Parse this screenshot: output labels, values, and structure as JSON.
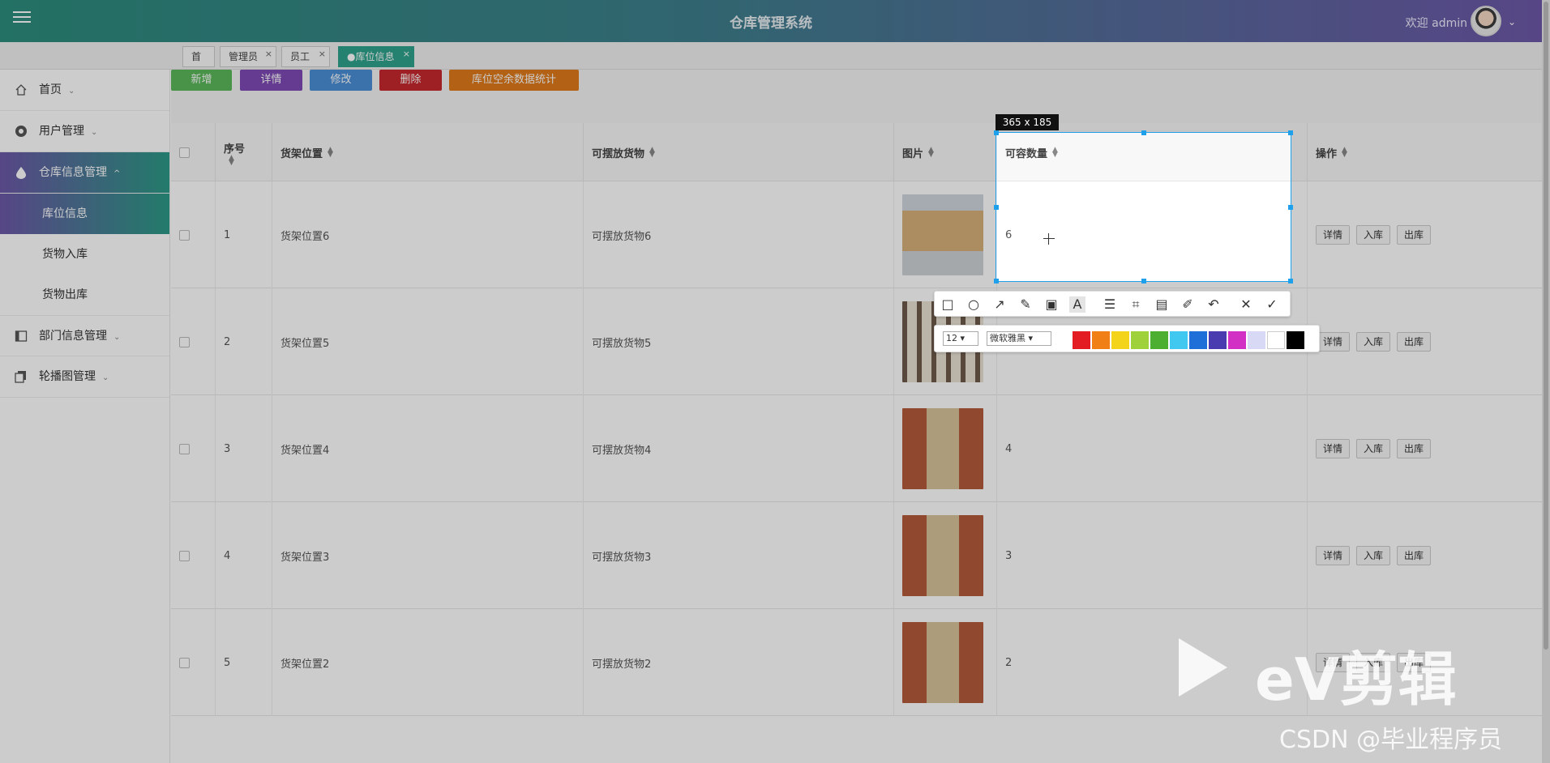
{
  "header": {
    "title": "仓库管理系统",
    "welcome": "欢迎 admin"
  },
  "tabs": [
    {
      "label": "首页",
      "closable": false
    },
    {
      "label": "管理员",
      "closable": true
    },
    {
      "label": "员工",
      "closable": true
    },
    {
      "label": "●库位信息",
      "closable": true,
      "active": true
    }
  ],
  "sidebar": {
    "items": [
      {
        "label": "首页",
        "icon": "home-icon"
      },
      {
        "label": "用户管理",
        "icon": "user-icon"
      },
      {
        "label": "仓库信息管理",
        "icon": "drop-icon",
        "open": true,
        "children": [
          "库位信息",
          "货物入库",
          "货物出库"
        ]
      },
      {
        "label": "部门信息管理",
        "icon": "book-icon"
      },
      {
        "label": "轮播图管理",
        "icon": "copy-icon"
      }
    ]
  },
  "actions": {
    "add": "新增",
    "detail": "详情",
    "edit": "修改",
    "delete": "删除",
    "stats": "库位空余数据统计",
    "colors": {
      "add": "#5cb85c",
      "detail": "#7d4ab5",
      "edit": "#4a8fd6",
      "delete": "#c7282d",
      "stats": "#e07a1a"
    }
  },
  "table": {
    "columns": [
      "序号",
      "货架位置",
      "可摆放货物",
      "图片",
      "可容数量",
      "操作"
    ],
    "rows": [
      {
        "no": "1",
        "location": "货架位置6",
        "goods": "可摆放货物6",
        "qty": "6",
        "img": "boxes"
      },
      {
        "no": "2",
        "location": "货架位置5",
        "goods": "可摆放货物5",
        "qty": "",
        "img": "shelves"
      },
      {
        "no": "3",
        "location": "货架位置4",
        "goods": "可摆放货物4",
        "qty": "4",
        "img": "aisle"
      },
      {
        "no": "4",
        "location": "货架位置3",
        "goods": "可摆放货物3",
        "qty": "3",
        "img": "aisle"
      },
      {
        "no": "5",
        "location": "货架位置2",
        "goods": "可摆放货物2",
        "qty": "2",
        "img": "aisle"
      }
    ],
    "row_ops": [
      "详情",
      "入库",
      "出库"
    ]
  },
  "capture": {
    "size_label": "365 x 185",
    "font_size": "12",
    "font_name": "微软雅黑",
    "palette": [
      "#e31b23",
      "#f07f16",
      "#f3d41a",
      "#9fd13b",
      "#4caf32",
      "#40c8f0",
      "#1f6fd9",
      "#4a3cb0",
      "#d22fc5",
      "#d7d9f5",
      "#ffffff",
      "#000000"
    ]
  },
  "watermark": {
    "brand": "eV剪辑",
    "csdn": "CSDN @毕业程序员"
  }
}
